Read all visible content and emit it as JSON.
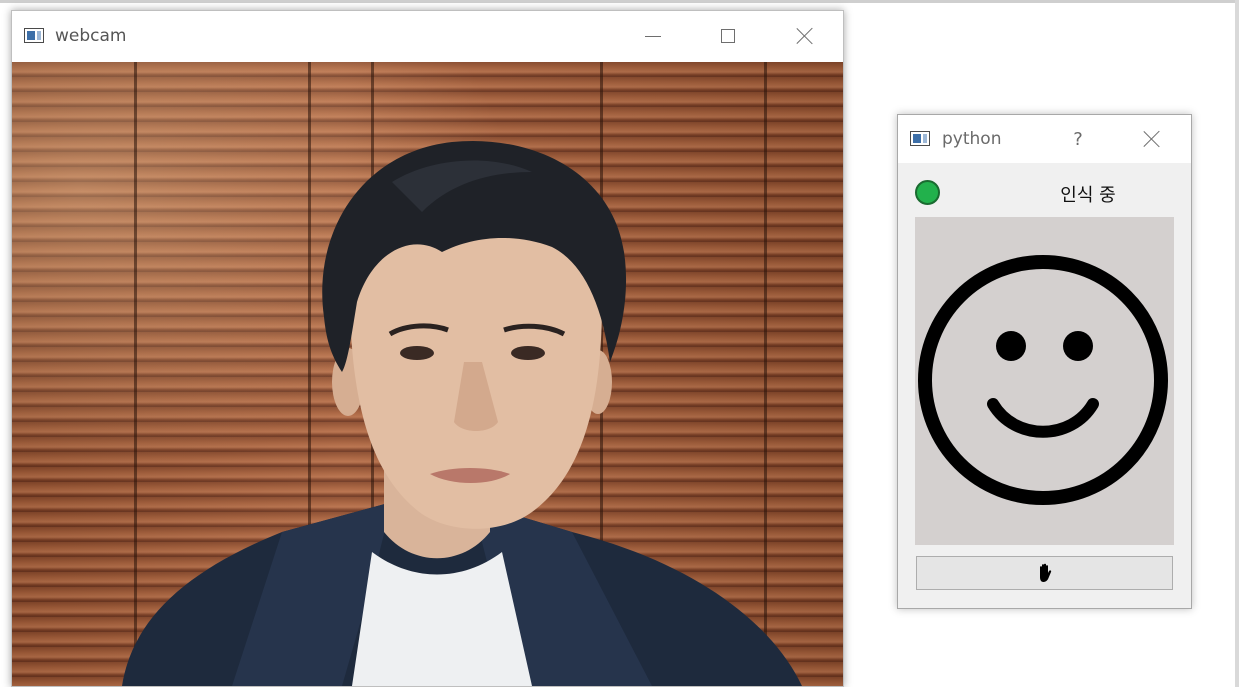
{
  "webcam_window": {
    "title": "webcam",
    "icon": "window-app-icon",
    "controls": [
      "minimize",
      "maximize",
      "close"
    ]
  },
  "python_window": {
    "title": "python",
    "help_label": "?",
    "status": {
      "indicator_color": "#22b14c",
      "text": "인식 중"
    },
    "emoji": "smiley-face-icon",
    "hand_button_icon": "hand-stop-icon"
  },
  "colors": {
    "status_green": "#22b14c",
    "emoji_panel_bg": "#d4d0cf"
  }
}
